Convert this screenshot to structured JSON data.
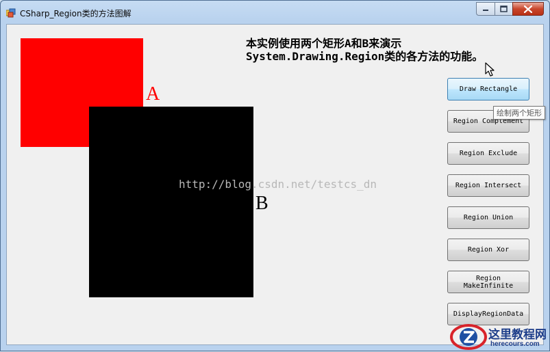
{
  "window": {
    "title": "CSharp_Region类的方法图解"
  },
  "canvas": {
    "description_lines": "本实例使用两个矩形A和B来演示\nSystem.Drawing.Region类的各方法的功能。",
    "label_a": "A",
    "label_b": "B",
    "rect_a_color": "#ff0000",
    "rect_b_color": "#000000",
    "watermark": "http://blog.csdn.net/testcs_dn"
  },
  "buttons": [
    {
      "label": "Draw Rectangle"
    },
    {
      "label": "Region Complement"
    },
    {
      "label": "Region Exclude"
    },
    {
      "label": "Region Intersect"
    },
    {
      "label": "Region Union"
    },
    {
      "label": "Region Xor"
    },
    {
      "label": "Region MakeInfinite"
    },
    {
      "label": "DisplayRegionData"
    }
  ],
  "tooltip": {
    "text": "绘制两个矩形"
  },
  "logo": {
    "title": "这里教程网",
    "subtitle": "herecours.com"
  },
  "icons": {
    "app": "app-window-icon",
    "minimize": "minimize-icon",
    "maximize": "maximize-icon",
    "close": "close-icon",
    "cursor": "mouse-pointer-icon"
  }
}
